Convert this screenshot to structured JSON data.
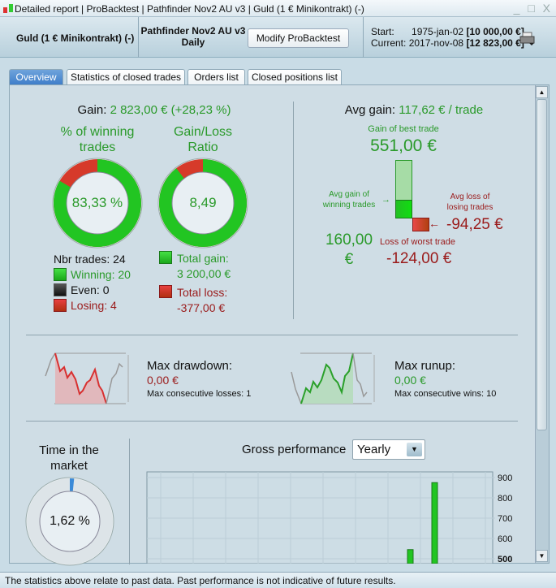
{
  "window": {
    "title": "Detailed report | ProBacktest | Pathfinder Nov2 AU v3 | Guld (1 € Minikontrakt) (-)",
    "controls": "_ □ X"
  },
  "header": {
    "instrument": "Guld (1 € Minikontrakt) (-)",
    "system": "Pathfinder Nov2 AU v3",
    "timeframe": "Daily",
    "modify_label": "Modify ProBacktest",
    "start_label": "Start:",
    "start_date": "1975-jan-02",
    "start_value": "[10 000,00 €]",
    "current_label": "Current:",
    "current_date": "2017-nov-08",
    "current_value": "[12 823,00 €]"
  },
  "tabs": [
    {
      "label": "Overview",
      "active": true
    },
    {
      "label": "Statistics of closed trades"
    },
    {
      "label": "Orders list"
    },
    {
      "label": "Closed positions list"
    }
  ],
  "gain": {
    "label": "Gain:",
    "value": "2 823,00 € (+28,23 %)"
  },
  "winning": {
    "title1": "% of winning",
    "title2": "trades",
    "value": "83,33 %",
    "fraction": 0.8333,
    "nbr": "Nbr trades: 24",
    "winning": "Winning: 20",
    "even": "Even: 0",
    "losing": "Losing: 4"
  },
  "ratio": {
    "title1": "Gain/Loss",
    "title2": "Ratio",
    "value": "8,49",
    "total_gain_label": "Total gain:",
    "total_gain": "3 200,00 €",
    "total_loss_label": "Total loss:",
    "total_loss": "-377,00 €"
  },
  "avg": {
    "label": "Avg gain:",
    "value": "117,62 € / trade",
    "best_label": "Gain of best trade",
    "best": "551,00 €",
    "avg_win_label1": "Avg gain of",
    "avg_win_label2": "winning trades",
    "avg_win1": "160,00",
    "avg_win2": "€",
    "avg_loss_label1": "Avg loss of",
    "avg_loss_label2": "losing trades",
    "avg_loss": "-94,25 €",
    "worst_label": "Loss of worst trade",
    "worst": "-124,00 €"
  },
  "drawdown": {
    "label": "Max drawdown:",
    "value": "0,00 €",
    "consec": "Max consecutive losses: 1"
  },
  "runup": {
    "label": "Max runup:",
    "value": "0,00 €",
    "consec": "Max consecutive wins: 10"
  },
  "market": {
    "title1": "Time in the",
    "title2": "market",
    "value": "1,62 %",
    "fraction": 0.0162
  },
  "performance": {
    "title": "Gross performance",
    "period": "Yearly"
  },
  "chart_data": {
    "type": "bar",
    "series": [
      {
        "values": [
          545,
          875
        ]
      }
    ],
    "yticks": [
      "900",
      "800",
      "700",
      "600",
      "500"
    ],
    "ylim_visible": [
      490,
      920
    ],
    "grid": true,
    "color": "#22c522"
  },
  "status": "The statistics above relate to past data. Past performance is not indicative of future results.",
  "colors": {
    "green": "#2a9a2a",
    "red": "#9a1a1a",
    "accent": "#3d7cc8"
  }
}
